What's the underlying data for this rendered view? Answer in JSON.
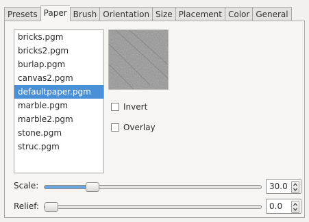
{
  "tabs": [
    {
      "label": "Presets",
      "active": false
    },
    {
      "label": "Paper",
      "active": true
    },
    {
      "label": "Brush",
      "active": false
    },
    {
      "label": "Orientation",
      "active": false
    },
    {
      "label": "Size",
      "active": false
    },
    {
      "label": "Placement",
      "active": false
    },
    {
      "label": "Color",
      "active": false
    },
    {
      "label": "General",
      "active": false
    }
  ],
  "paper_list": {
    "items": [
      "bricks.pgm",
      "bricks2.pgm",
      "burlap.pgm",
      "canvas2.pgm",
      "defaultpaper.pgm",
      "marble.pgm",
      "marble2.pgm",
      "stone.pgm",
      "struc.pgm"
    ],
    "selected": "defaultpaper.pgm"
  },
  "invert": {
    "label": "Invert",
    "checked": false
  },
  "overlay": {
    "label": "Overlay",
    "checked": false
  },
  "scale": {
    "label": "Scale:",
    "value": "30.0",
    "fraction": 0.2
  },
  "relief": {
    "label": "Relief:",
    "value": "0.0",
    "fraction": 0.0
  },
  "colors": {
    "selection": "#4a90d9",
    "slider_fill": "#6da6de"
  }
}
